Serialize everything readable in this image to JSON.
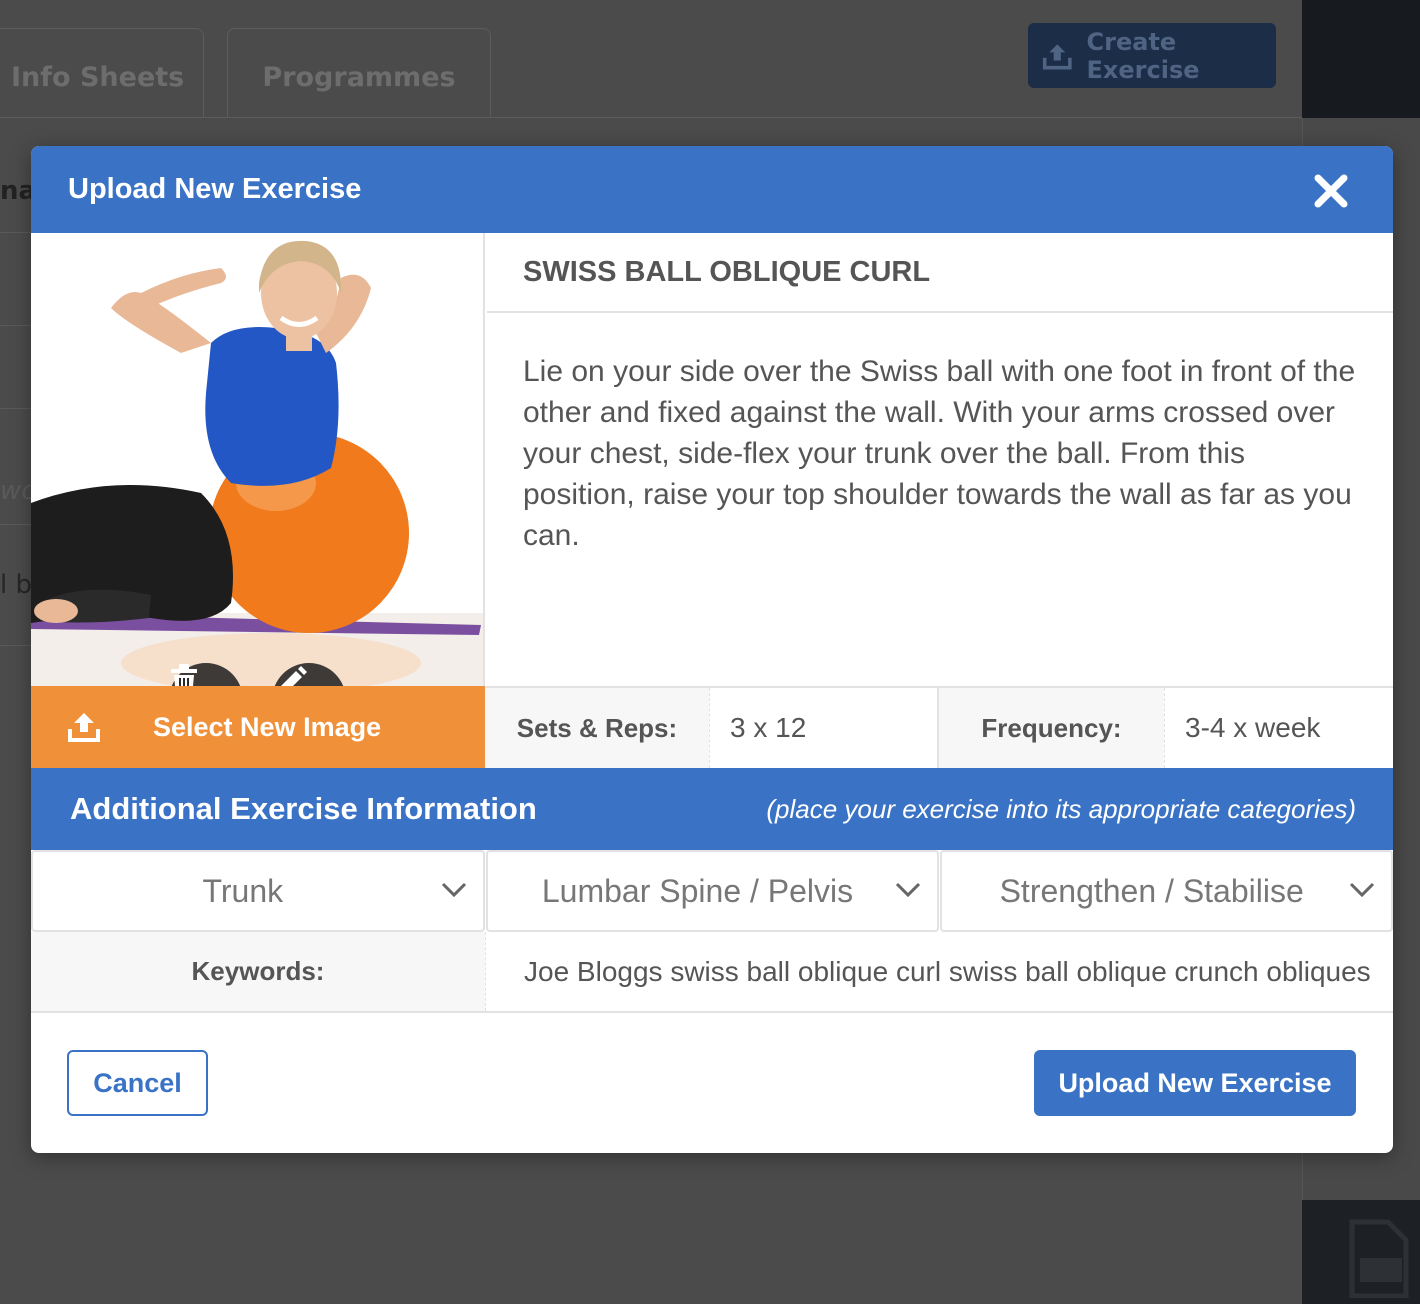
{
  "background": {
    "tabs": [
      "Info Sheets",
      "Programmes"
    ],
    "create_button_label": "Create Exercise",
    "left_fragments": [
      "nal",
      "wo",
      "l b"
    ]
  },
  "modal": {
    "title": "Upload New Exercise",
    "close_icon": "close-icon",
    "exercise_name": "SWISS BALL OBLIQUE CURL",
    "description": "Lie on your side over the Swiss ball with one foot in front of the other and fixed against the wall. With your arms crossed over your chest, side-flex your trunk over the ball. From this position, raise your top shoulder towards the wall as far as you can.",
    "select_image_label": "Select New Image",
    "sets_reps_label": "Sets & Reps:",
    "sets_reps_value": "3 x 12",
    "frequency_label": "Frequency:",
    "frequency_value": "3-4 x week",
    "additional_title": "Additional Exercise Information",
    "additional_hint": "(place your exercise into its appropriate categories)",
    "categories": [
      "Trunk",
      "Lumbar Spine / Pelvis",
      "Strengthen / Stabilise"
    ],
    "keywords_label": "Keywords:",
    "keywords_value": "Joe Bloggs swiss ball oblique curl swiss ball oblique crunch obliques",
    "cancel_label": "Cancel",
    "upload_label": "Upload New Exercise"
  },
  "colors": {
    "header_blue": "#3a73c6",
    "select_image_orange": "#f0913a",
    "overlay": "#4b4b4b"
  }
}
